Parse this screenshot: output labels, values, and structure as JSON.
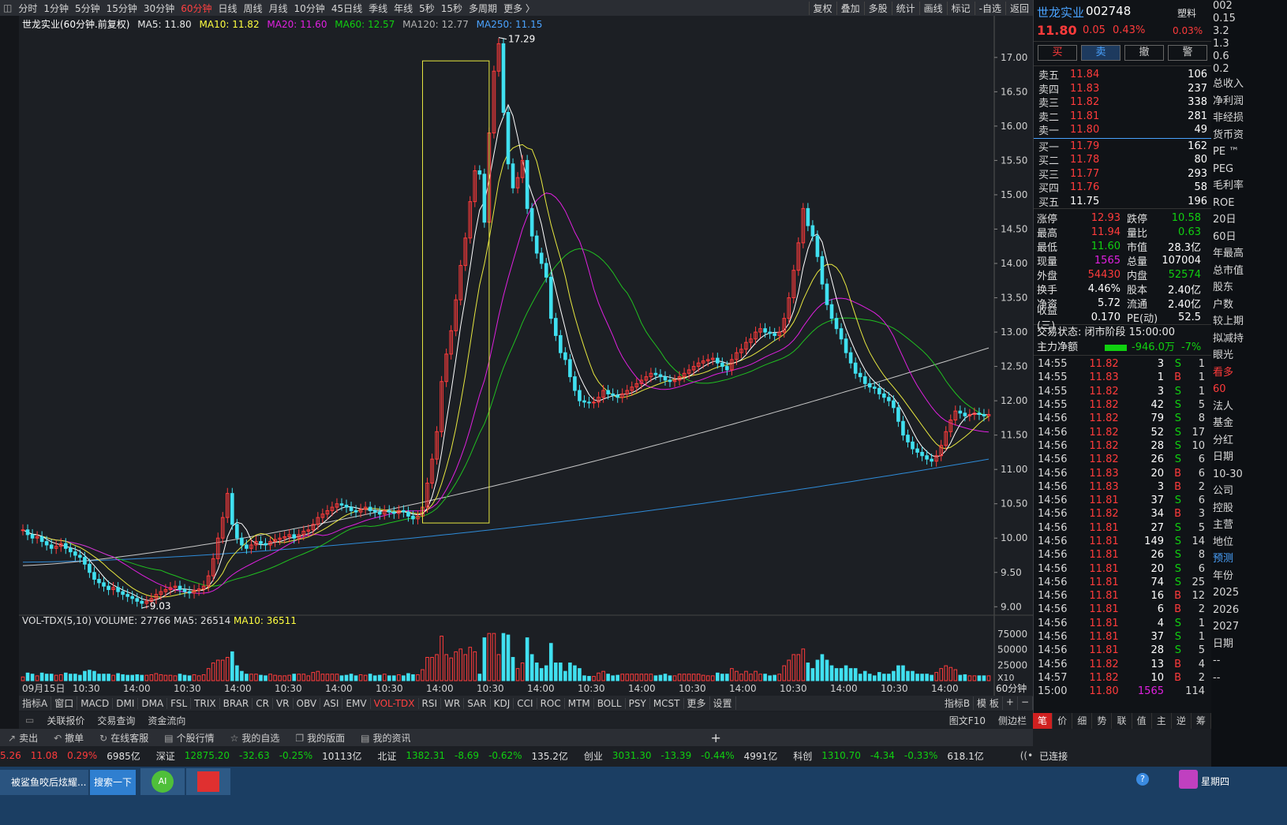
{
  "timeframes": [
    "分时",
    "1分钟",
    "5分钟",
    "15分钟",
    "30分钟",
    "60分钟",
    "日线",
    "周线",
    "月线",
    "10分钟",
    "45日线",
    "季线",
    "年线",
    "5秒",
    "15秒",
    "多周期",
    "更多 〉"
  ],
  "active_timeframe": "60分钟",
  "top_right_tools": [
    "复权",
    "叠加",
    "多股",
    "统计",
    "画线",
    "标记",
    "-自选",
    "返回"
  ],
  "ma_header": {
    "label": "世龙实业(60分钟.前复权)",
    "ma5": "MA5: 11.80",
    "ma10": "MA10: 11.82",
    "ma20": "MA20: 11.60",
    "ma60": "MA60: 12.57",
    "ma120": "MA120: 12.77",
    "ma250": "MA250: 11.15"
  },
  "chart_data": {
    "type": "candlestick",
    "period": "60分钟",
    "y_ticks": [
      "17.00",
      "16.50",
      "16.00",
      "15.50",
      "15.00",
      "14.50",
      "14.00",
      "13.50",
      "13.00",
      "12.50",
      "12.00",
      "11.50",
      "11.00",
      "10.50",
      "10.00",
      "9.50",
      "9.00"
    ],
    "ylim": [
      8.9,
      17.4
    ],
    "high_label": "17.29",
    "low_label": "9.03",
    "x_labels": [
      "09月15日",
      "10:30",
      "14:00",
      "10:30",
      "14:00",
      "10:30",
      "14:00",
      "10:30",
      "14:00",
      "10:30",
      "14:00",
      "10:30",
      "14:00",
      "10:30",
      "14:00",
      "10:30",
      "14:00",
      "10:30",
      "14:00"
    ],
    "closes": [
      10.12,
      10.05,
      10.0,
      10.02,
      9.95,
      9.9,
      9.85,
      9.88,
      9.92,
      9.85,
      9.8,
      9.75,
      9.72,
      9.62,
      9.5,
      9.4,
      9.35,
      9.3,
      9.25,
      9.28,
      9.22,
      9.18,
      9.15,
      9.12,
      9.08,
      9.05,
      9.08,
      9.12,
      9.18,
      9.22,
      9.25,
      9.28,
      9.3,
      9.25,
      9.22,
      9.2,
      9.24,
      9.26,
      9.3,
      9.45,
      9.7,
      10.0,
      10.3,
      10.65,
      10.2,
      10.0,
      9.9,
      9.85,
      9.9,
      9.95,
      9.92,
      9.9,
      9.95,
      9.98,
      10.0,
      10.02,
      10.05,
      10.0,
      10.05,
      10.1,
      10.12,
      10.2,
      10.3,
      10.35,
      10.4,
      10.45,
      10.5,
      10.48,
      10.45,
      10.4,
      10.38,
      10.42,
      10.45,
      10.4,
      10.38,
      10.35,
      10.4,
      10.38,
      10.36,
      10.4,
      10.38,
      10.32,
      10.28,
      10.32,
      10.45,
      10.8,
      11.15,
      11.55,
      12.28,
      12.68,
      13.02,
      13.47,
      13.97,
      14.37,
      14.9,
      15.35,
      15.3,
      14.6,
      15.9,
      16.8,
      17.2,
      16.2,
      15.45,
      15.1,
      15.25,
      15.5,
      14.8,
      14.4,
      14.15,
      14.0,
      13.8,
      13.2,
      12.95,
      12.7,
      12.6,
      12.35,
      12.15,
      12.0,
      11.98,
      11.97,
      11.98,
      12.05,
      12.15,
      12.1,
      12.08,
      12.05,
      12.1,
      12.15,
      12.2,
      12.25,
      12.3,
      12.35,
      12.4,
      12.38,
      12.35,
      12.3,
      12.28,
      12.3,
      12.35,
      12.4,
      12.45,
      12.5,
      12.55,
      12.58,
      12.6,
      12.62,
      12.55,
      12.5,
      12.45,
      12.6,
      12.7,
      12.75,
      12.85,
      12.9,
      13.0,
      13.05,
      13.0,
      12.98,
      12.95,
      13.0,
      13.2,
      13.5,
      13.9,
      14.3,
      14.8,
      14.55,
      14.4,
      14.1,
      13.7,
      13.4,
      13.2,
      13.05,
      12.9,
      12.7,
      12.55,
      12.4,
      12.35,
      12.25,
      12.2,
      12.18,
      12.1,
      12.05,
      12.0,
      11.9,
      11.7,
      11.5,
      11.4,
      11.3,
      11.25,
      11.2,
      11.15,
      11.12,
      11.2,
      11.35,
      11.55,
      11.72,
      11.85,
      11.82,
      11.78,
      11.8,
      11.82,
      11.8,
      11.78,
      11.8
    ],
    "ma120_last": 12.77,
    "ma250_last": 11.15,
    "vol_ticks": [
      "75000",
      "50000",
      "25000"
    ],
    "vol_unit": "X10",
    "vol_header": {
      "name": "VOL-TDX(5,10)",
      "volume": "VOLUME: 27766",
      "ma5": "MA5: 26514",
      "ma10": "MA10: 36511"
    }
  },
  "indicator_tabs": [
    "指标A",
    "窗口",
    "MACD",
    "DMI",
    "DMA",
    "FSL",
    "TRIX",
    "BRAR",
    "CR",
    "VR",
    "OBV",
    "ASI",
    "EMV",
    "VOL-TDX",
    "RSI",
    "WR",
    "SAR",
    "KDJ",
    "CCI",
    "ROC",
    "MTM",
    "BOLL",
    "PSY",
    "MCST",
    "更多",
    "设置"
  ],
  "active_indicator": "VOL-TDX",
  "indicator_right": [
    "指标B",
    "模 板",
    "+",
    "−"
  ],
  "link_tabs": [
    "关联报价",
    "交易查询",
    "资金流向"
  ],
  "link_right": [
    "图文F10",
    "侧边栏"
  ],
  "actions": [
    "卖出",
    "撤单",
    "在线客服",
    "个股行情",
    "我的自选",
    "我的版面",
    "我的资讯"
  ],
  "indices": [
    {
      "name": "",
      "val": "5.26",
      "chg": "11.08",
      "pct": "0.29%",
      "amt": "6985亿"
    },
    {
      "name": "深证",
      "val": "12875.20",
      "chg": "-32.63",
      "pct": "-0.25%",
      "amt": "10113亿"
    },
    {
      "name": "北证",
      "val": "1382.31",
      "chg": "-8.69",
      "pct": "-0.62%",
      "amt": "135.2亿"
    },
    {
      "name": "创业",
      "val": "3031.30",
      "chg": "-13.39",
      "pct": "-0.44%",
      "amt": "4991亿"
    },
    {
      "name": "科创",
      "val": "1310.70",
      "chg": "-4.34",
      "pct": "-0.33%",
      "amt": "618.1亿"
    }
  ],
  "conn": "已连接",
  "taskbar": {
    "task": "被鲨鱼咬后炫耀...",
    "search": "搜索一下",
    "weekday": "星期四"
  },
  "stock": {
    "name": "世龙实业",
    "code": "002748",
    "tag": "塑料",
    "price": "11.80",
    "chg": "0.05",
    "pct": "0.43%",
    "tag_pct": "0.03%"
  },
  "order_buttons": [
    "买",
    "卖",
    "撤",
    "警"
  ],
  "sell_levels": [
    {
      "l": "卖五",
      "p": "11.84",
      "q": "106"
    },
    {
      "l": "卖四",
      "p": "11.83",
      "q": "237"
    },
    {
      "l": "卖三",
      "p": "11.82",
      "q": "338"
    },
    {
      "l": "卖二",
      "p": "11.81",
      "q": "281"
    },
    {
      "l": "卖一",
      "p": "11.80",
      "q": "49"
    }
  ],
  "buy_levels": [
    {
      "l": "买一",
      "p": "11.79",
      "q": "162"
    },
    {
      "l": "买二",
      "p": "11.78",
      "q": "80"
    },
    {
      "l": "买三",
      "p": "11.77",
      "q": "293"
    },
    {
      "l": "买四",
      "p": "11.76",
      "q": "58"
    },
    {
      "l": "买五",
      "p": "11.75",
      "q": "196"
    }
  ],
  "stats": [
    [
      {
        "k": "涨停",
        "v": "12.93",
        "c": "red"
      },
      {
        "k": "跌停",
        "v": "10.58",
        "c": "grn"
      }
    ],
    [
      {
        "k": "最高",
        "v": "11.94",
        "c": "red"
      },
      {
        "k": "量比",
        "v": "0.63",
        "c": "grn"
      }
    ],
    [
      {
        "k": "最低",
        "v": "11.60",
        "c": "grn"
      },
      {
        "k": "市值",
        "v": "28.3亿",
        "c": "wht"
      }
    ],
    [
      {
        "k": "现量",
        "v": "1565",
        "c": "mag"
      },
      {
        "k": "总量",
        "v": "107004",
        "c": "wht"
      }
    ],
    [
      {
        "k": "外盘",
        "v": "54430",
        "c": "red"
      },
      {
        "k": "内盘",
        "v": "52574",
        "c": "grn"
      }
    ],
    [
      {
        "k": "换手",
        "v": "4.46%",
        "c": "wht"
      },
      {
        "k": "股本",
        "v": "2.40亿",
        "c": "wht"
      }
    ],
    [
      {
        "k": "净资",
        "v": "5.72",
        "c": "wht"
      },
      {
        "k": "流通",
        "v": "2.40亿",
        "c": "wht"
      }
    ],
    [
      {
        "k": "收益(三)",
        "v": "0.170",
        "c": "wht"
      },
      {
        "k": "PE(动)",
        "v": "52.5",
        "c": "wht"
      }
    ]
  ],
  "trade_status": "交易状态: 闭市阶段 15:00:00",
  "main_flow": {
    "label": "主力净额",
    "val": "-946.0万",
    "pct": "-7%"
  },
  "ticks": [
    [
      "14:55",
      "11.82",
      "3",
      "S",
      "1"
    ],
    [
      "14:55",
      "11.83",
      "1",
      "B",
      "1"
    ],
    [
      "14:55",
      "11.82",
      "3",
      "S",
      "1"
    ],
    [
      "14:55",
      "11.82",
      "42",
      "S",
      "5"
    ],
    [
      "14:56",
      "11.82",
      "79",
      "S",
      "8"
    ],
    [
      "14:56",
      "11.82",
      "52",
      "S",
      "17"
    ],
    [
      "14:56",
      "11.82",
      "28",
      "S",
      "10"
    ],
    [
      "14:56",
      "11.82",
      "26",
      "S",
      "6"
    ],
    [
      "14:56",
      "11.83",
      "20",
      "B",
      "6"
    ],
    [
      "14:56",
      "11.83",
      "3",
      "B",
      "2"
    ],
    [
      "14:56",
      "11.81",
      "37",
      "S",
      "6"
    ],
    [
      "14:56",
      "11.82",
      "34",
      "B",
      "3"
    ],
    [
      "14:56",
      "11.81",
      "27",
      "S",
      "5"
    ],
    [
      "14:56",
      "11.81",
      "149",
      "S",
      "14"
    ],
    [
      "14:56",
      "11.81",
      "26",
      "S",
      "8"
    ],
    [
      "14:56",
      "11.81",
      "20",
      "S",
      "6"
    ],
    [
      "14:56",
      "11.81",
      "74",
      "S",
      "25"
    ],
    [
      "14:56",
      "11.81",
      "16",
      "B",
      "12"
    ],
    [
      "14:56",
      "11.81",
      "6",
      "B",
      "2"
    ],
    [
      "14:56",
      "11.81",
      "4",
      "S",
      "1"
    ],
    [
      "14:56",
      "11.81",
      "37",
      "S",
      "1"
    ],
    [
      "14:56",
      "11.81",
      "28",
      "S",
      "5"
    ],
    [
      "14:56",
      "11.82",
      "13",
      "B",
      "4"
    ],
    [
      "14:57",
      "11.82",
      "10",
      "B",
      "2"
    ],
    [
      "15:00",
      "11.80",
      "1565",
      "",
      "114"
    ]
  ],
  "bottom_tabs": [
    "笔",
    "价",
    "细",
    "势",
    "联",
    "值",
    "主",
    "逆",
    "筹"
  ],
  "far_right_lines": [
    "002",
    "0.15",
    "3.2",
    "1.3",
    "0.6",
    "0.2",
    "总收入",
    "净利润",
    "非经损",
    "货币资",
    "PE ™",
    "PEG",
    "毛利率",
    "ROE",
    "20日",
    "60日",
    "年最高",
    "总市值",
    "股东",
    "户数",
    "较上期",
    "拟减持",
    "眼光",
    "看多",
    "60",
    "法人",
    "基金",
    "分红",
    "日期",
    "10-30",
    "公司",
    "控股",
    "主营",
    "地位",
    "预测",
    "年份",
    "2025",
    "2026",
    "2027",
    "日期",
    "--",
    "--"
  ]
}
